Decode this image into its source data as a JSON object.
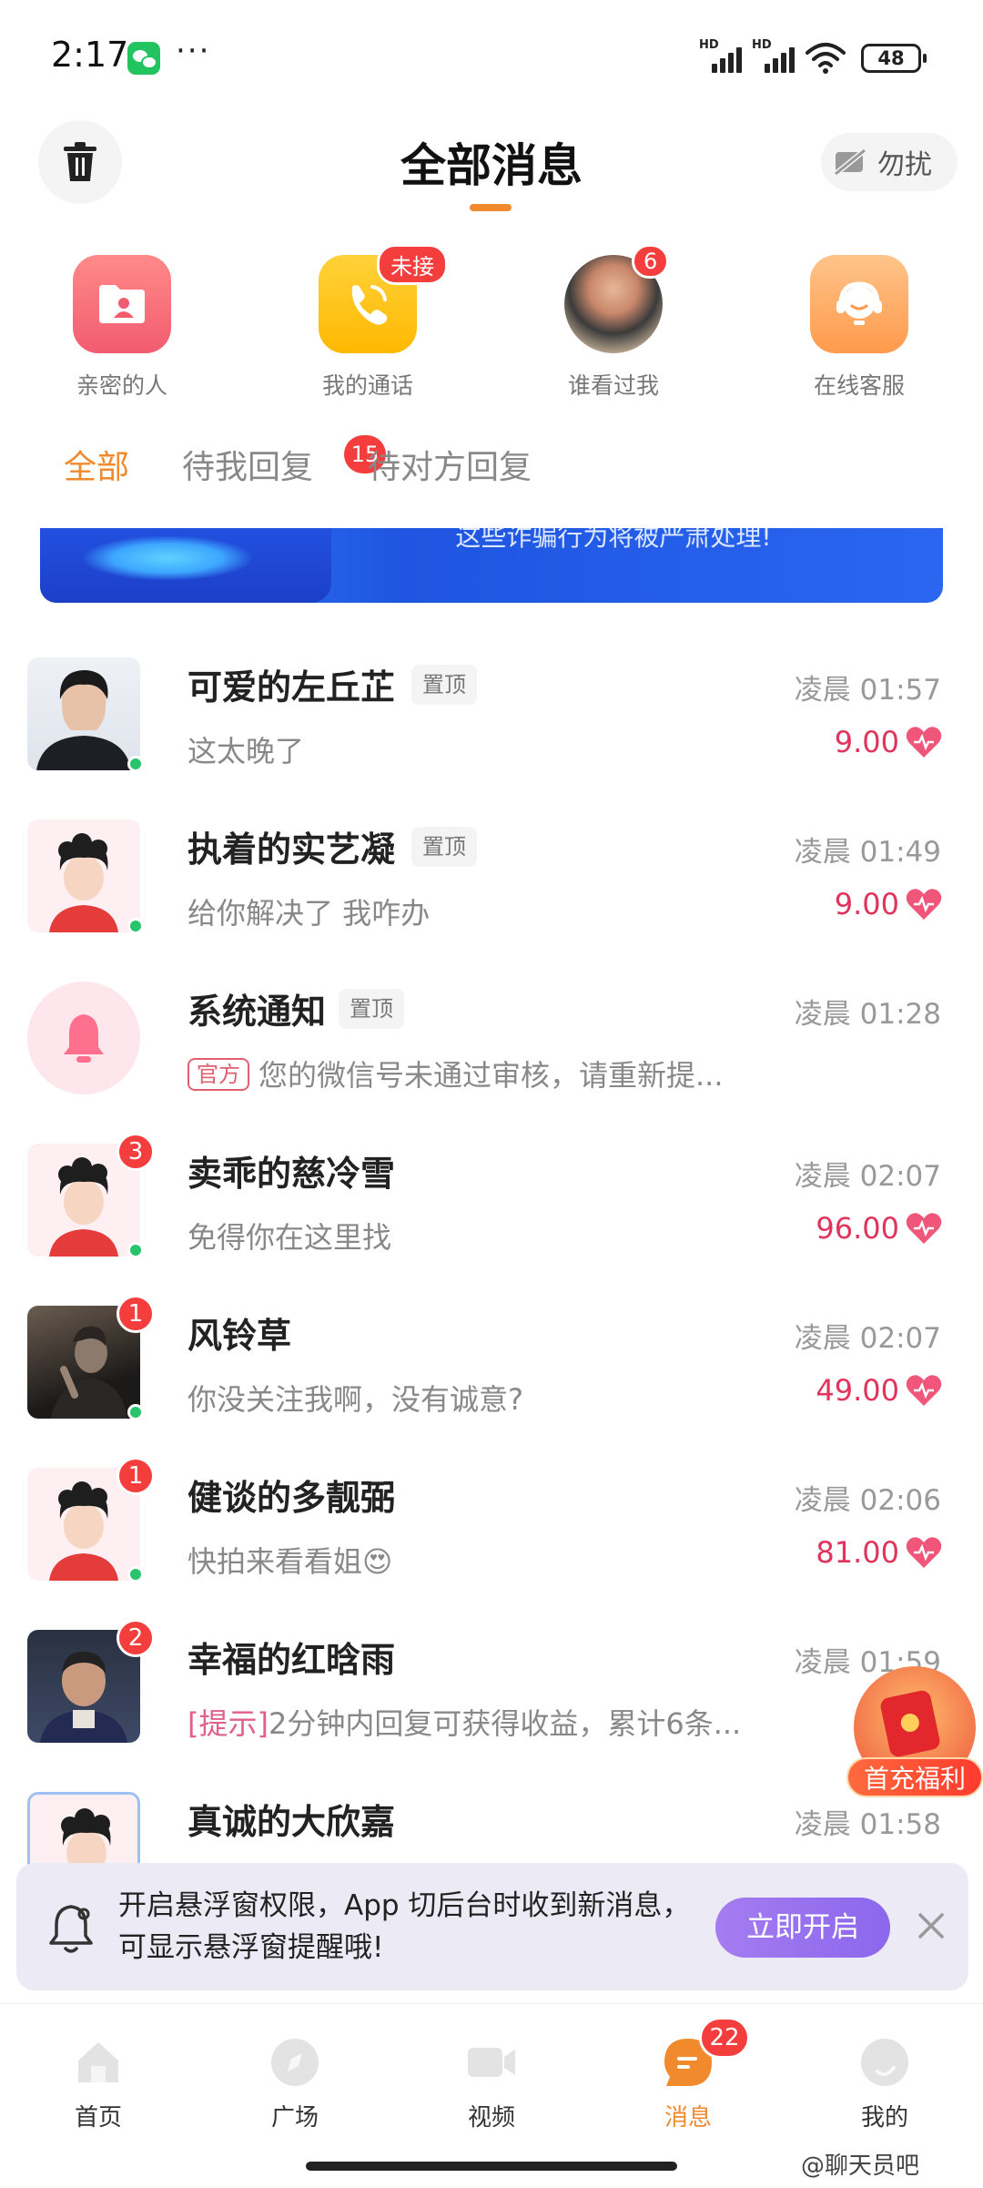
{
  "status_bar": {
    "time": "2:17",
    "more": "···",
    "signal_1": "HD",
    "signal_2": "HD",
    "battery": "48"
  },
  "header": {
    "title": "全部消息",
    "dnd_label": "勿扰",
    "accent_color": "#f08a2c"
  },
  "quick_entries": [
    {
      "label": "亲密的人",
      "icon": "intimate-folder-icon",
      "badge": ""
    },
    {
      "label": "我的通话",
      "icon": "phone-call-icon",
      "badge": "未接"
    },
    {
      "label": "谁看过我",
      "icon": "visitor-avatar",
      "badge": "6"
    },
    {
      "label": "在线客服",
      "icon": "customer-service-icon",
      "badge": ""
    }
  ],
  "tabs": [
    {
      "label": "全部",
      "active": true
    },
    {
      "label": "待我回复",
      "badge": "15"
    },
    {
      "label": "待对方回复"
    }
  ],
  "banner": {
    "text": "这些诈骗行为将被严肃处理!"
  },
  "messages": [
    {
      "name": "可爱的左丘芷",
      "pin": "置顶",
      "time": "凌晨 01:57",
      "preview": "这太晚了",
      "amount": "9.00",
      "unread": "",
      "online": true
    },
    {
      "name": "执着的实艺凝",
      "pin": "置顶",
      "time": "凌晨 01:49",
      "preview": "给你解决了 我咋办",
      "amount": "9.00",
      "unread": "",
      "online": true
    },
    {
      "name": "系统通知",
      "pin": "置顶",
      "time": "凌晨 01:28",
      "tag": "官方",
      "preview": "您的微信号未通过审核，请重新提...",
      "amount": "",
      "unread": "",
      "online": false
    },
    {
      "name": "卖乖的慈冷雪",
      "pin": "",
      "time": "凌晨 02:07",
      "preview": "免得你在这里找",
      "amount": "96.00",
      "unread": "3",
      "online": true
    },
    {
      "name": "风铃草",
      "pin": "",
      "time": "凌晨 02:07",
      "preview": "你没关注我啊，没有诚意?",
      "amount": "49.00",
      "unread": "1",
      "online": true
    },
    {
      "name": "健谈的多靓弼",
      "pin": "",
      "time": "凌晨 02:06",
      "preview": "快拍来看看姐😍",
      "amount": "81.00",
      "unread": "1",
      "online": true
    },
    {
      "name": "幸福的红晗雨",
      "pin": "",
      "time": "凌晨 01:59",
      "hint": "[提示]",
      "preview": "2分钟内回复可获得收益，累计6条...",
      "amount": "",
      "unread": "2",
      "online": false
    },
    {
      "name": "真诚的大欣嘉",
      "pin": "",
      "time": "凌晨 01:58",
      "preview": "",
      "amount": "",
      "unread": "",
      "online": false
    }
  ],
  "promo": {
    "label": "首充福利"
  },
  "notice": {
    "line1": "开启悬浮窗权限，App 切后台时收到新消息，",
    "line2": "可显示悬浮窗提醒哦!",
    "button": "立即开启"
  },
  "bottom_nav": [
    {
      "label": "首页",
      "icon": "home-icon"
    },
    {
      "label": "广场",
      "icon": "compass-icon"
    },
    {
      "label": "视频",
      "icon": "video-icon"
    },
    {
      "label": "消息",
      "icon": "message-icon",
      "badge": "22",
      "active": true
    },
    {
      "label": "我的",
      "icon": "profile-icon"
    }
  ],
  "watermark": "@聊天员吧"
}
